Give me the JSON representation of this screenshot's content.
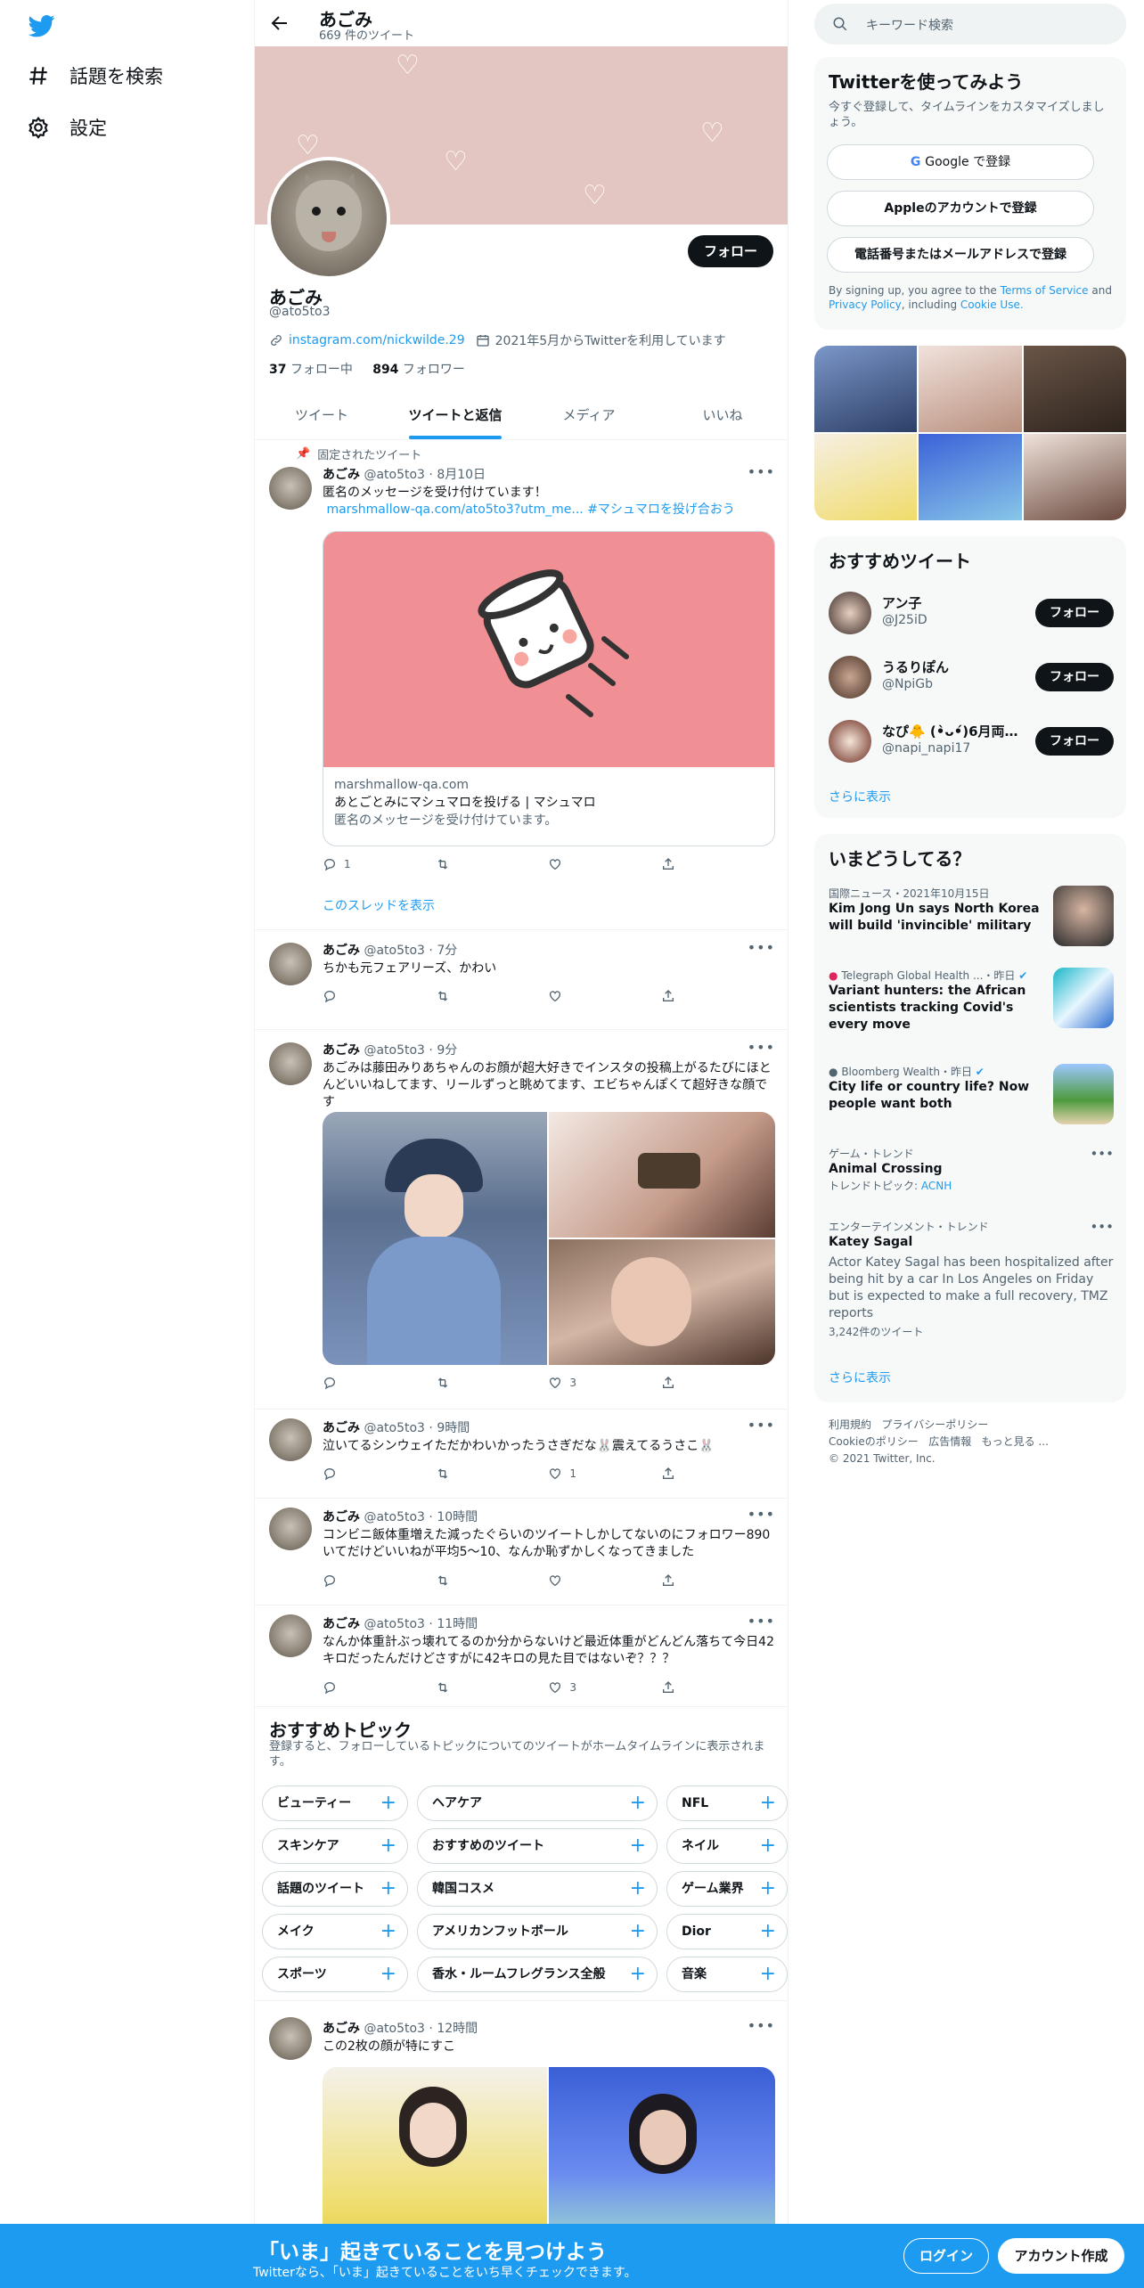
{
  "nav": {
    "explore": "話題を検索",
    "settings": "設定"
  },
  "profile": {
    "name": "あごみ",
    "tweet_count": "669 件のツイート",
    "handle": "@ato5to3",
    "link": "instagram.com/nickwilde.29",
    "joined": "2021年5月からTwitterを利用しています",
    "following_count": "37",
    "following_label": "フォロー中",
    "followers_count": "894",
    "followers_label": "フォロワー",
    "follow_button": "フォロー"
  },
  "tabs": [
    "ツイート",
    "ツイートと返信",
    "メディア",
    "いいね"
  ],
  "pinned_label": "固定されたツイート",
  "tweets": [
    {
      "name": "あごみ",
      "handle": "@ato5to3",
      "time": "8月10日",
      "text": "匿名のメッセージを受け付けています！",
      "link": "marshmallow-qa.com/ato5to3?utm_me...",
      "hashtag": "#マシュマロを投げ合おう",
      "card_domain": "marshmallow-qa.com",
      "card_title": "あとごとみにマシュマロを投げる | マシュマロ",
      "card_desc": "匿名のメッセージを受け付けています。",
      "replies": "1",
      "likes": "",
      "thread_link": "このスレッドを表示"
    },
    {
      "name": "あごみ",
      "handle": "@ato5to3",
      "time": "7分",
      "text": "ちかも元フェアリーズ、かわい",
      "replies": "",
      "likes": ""
    },
    {
      "name": "あごみ",
      "handle": "@ato5to3",
      "time": "9分",
      "text": "あごみは藤田みりあちゃんのお顔が超大好きでインスタの投稿上がるたびにほとんどいいねしてます、リールずっと眺めてます、エビちゃんぽくて超好きな顔です",
      "replies": "",
      "likes": "3"
    },
    {
      "name": "あごみ",
      "handle": "@ato5to3",
      "time": "9時間",
      "text": "泣いてるシンウェイただかわいかったうさぎだな🐰震えてるうさこ🐰",
      "replies": "",
      "likes": "1"
    },
    {
      "name": "あごみ",
      "handle": "@ato5to3",
      "time": "10時間",
      "text": "コンビニ飯体重増えた減ったぐらいのツイートしかしてないのにフォロワー890いてだけどいいねが平均5〜10、なんか恥ずかしくなってきました",
      "replies": "",
      "likes": ""
    },
    {
      "name": "あごみ",
      "handle": "@ato5to3",
      "time": "11時間",
      "text": "なんか体重計ぶっ壊れてるのか分からないけど最近体重がどんどん落ちて今日42キロだったんだけどさすがに42キロの見た目ではないぞ？？？",
      "replies": "",
      "likes": "3"
    },
    {
      "name": "あごみ",
      "handle": "@ato5to3",
      "time": "12時間",
      "text": "この2枚の顔が特にすこ"
    }
  ],
  "topics": {
    "title": "おすすめトピック",
    "subtitle": "登録すると、フォローしているトピックについてのツイートがホームタイムラインに表示されます。",
    "items": [
      "ビューティー",
      "ヘアケア",
      "NFL",
      "スキンケア",
      "おすすめのツイート",
      "ネイル",
      "話題のツイート",
      "韓国コスメ",
      "ゲーム業界",
      "メイク",
      "アメリカンフットボール",
      "Dior",
      "スポーツ",
      "香水・ルームフレグランス全般",
      "音楽"
    ]
  },
  "right": {
    "search_placeholder": "キーワード検索",
    "signup_title": "Twitterを使ってみよう",
    "signup_sub": "今すぐ登録して、タイムラインをカスタマイズしましょう。",
    "google_btn": "Google で登録",
    "apple_btn": "Appleのアカウントで登録",
    "phone_btn": "電話番号またはメールアドレスで登録",
    "terms_prefix": "By signing up, you agree to the",
    "terms_link": "Terms of Service",
    "terms_and": "and",
    "privacy_link": "Privacy Policy",
    "including": ", including",
    "cookie_link": "Cookie Use.",
    "rec_title": "おすすめツイート",
    "recs": [
      {
        "name": "アン子",
        "handle": "@J25iD"
      },
      {
        "name": "うるりぽん",
        "handle": "@NpiGb"
      },
      {
        "name": "なぴ🐥 (•̀ᴗ•́)6月両顎＋...",
        "handle": "@napi_napi17"
      }
    ],
    "rec_follow": "フォロー",
    "show_more": "さらに表示",
    "trends_title": "いまどうしてる？",
    "trends": [
      {
        "meta": "国際ニュース・2021年10月15日",
        "text": "Kim Jong Un says North Korea will build 'invincible' military"
      },
      {
        "meta": "Telegraph Global Health ...・昨日",
        "text": "Variant hunters: the African scientists tracking Covid's every move"
      },
      {
        "meta": "Bloomberg Wealth・昨日",
        "text": "City life or country life? Now people want both"
      },
      {
        "meta": "ゲーム・トレンド",
        "text": "Animal Crossing",
        "sub_label": "トレンドトピック:",
        "sub_link": "ACNH"
      },
      {
        "meta": "エンターテインメント・トレンド",
        "text": "Katey Sagal",
        "desc": "Actor Katey Sagal has been hospitalized after being hit by a car In Los Angeles on Friday but is expected to make a full recovery, TMZ reports",
        "count": "3,242件のツイート"
      }
    ],
    "footer": {
      "terms": "利用規約",
      "privacy": "プライバシーポリシー",
      "cookie": "Cookieのポリシー",
      "ads": "広告情報",
      "more": "もっと見る ...",
      "copyright": "© 2021 Twitter, Inc."
    }
  },
  "bottom": {
    "headline": "「いま」起きていることを見つけよう",
    "sub": "Twitterなら、「いま」起きていることをいち早くチェックできます。",
    "login": "ログイン",
    "signup": "アカウント作成"
  },
  "colors": {
    "accent": "#1d9bf0",
    "banner": "#e3c6c1",
    "card": "#f08f94"
  }
}
